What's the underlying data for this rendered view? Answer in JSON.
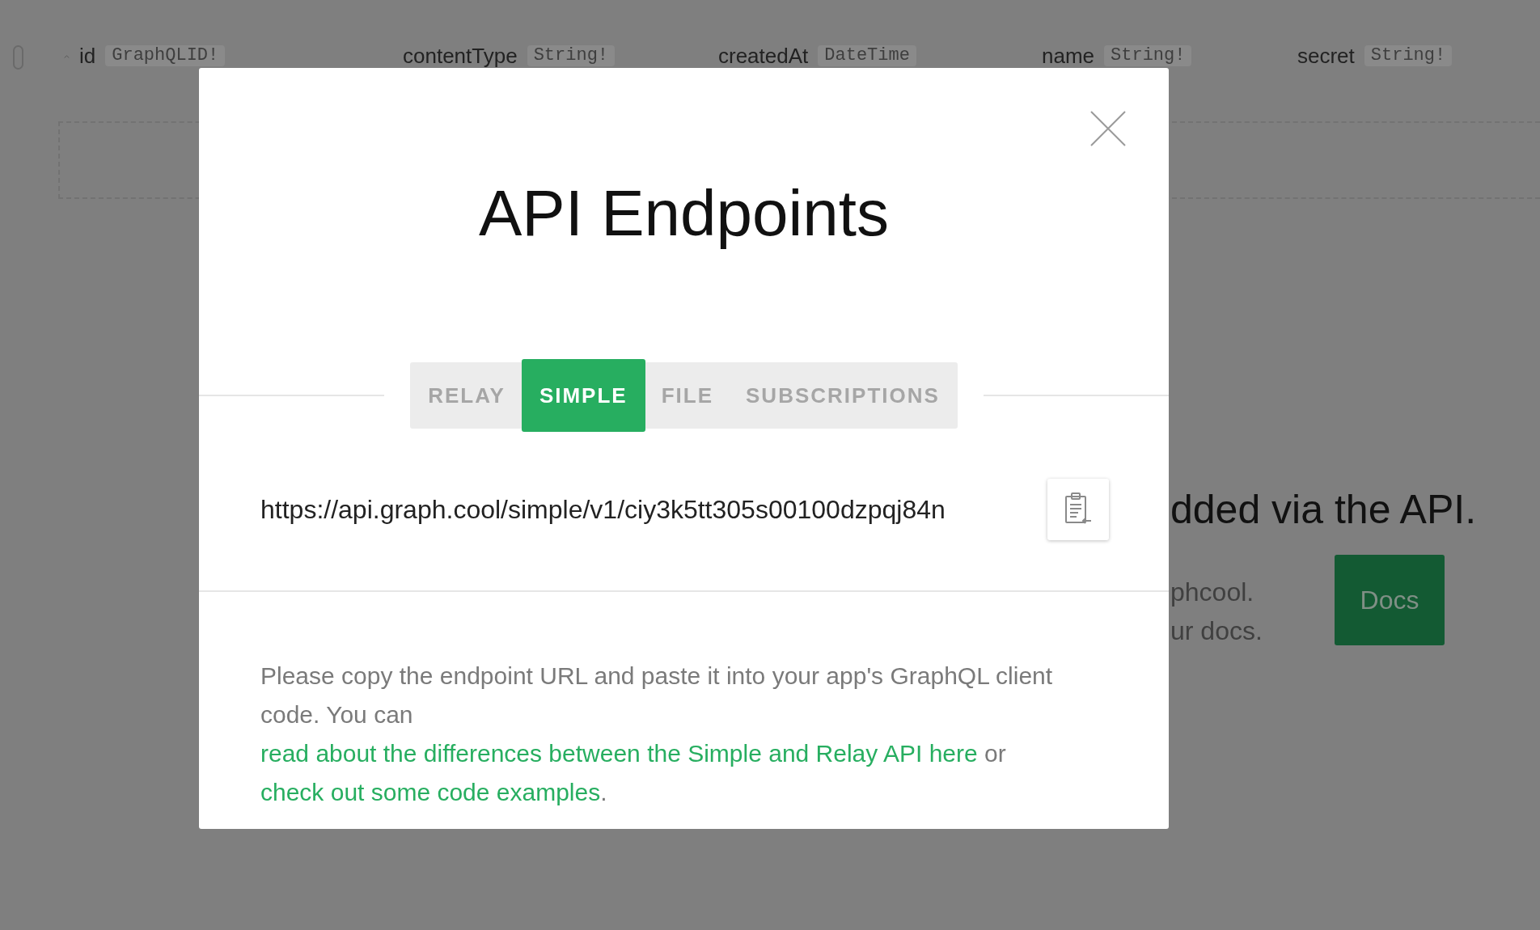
{
  "background": {
    "row_checked": false,
    "fields": [
      {
        "name": "id",
        "type": "GraphQLID!"
      },
      {
        "name": "contentType",
        "type": "String!"
      },
      {
        "name": "createdAt",
        "type": "DateTime"
      },
      {
        "name": "name",
        "type": "String!"
      },
      {
        "name": "secret",
        "type": "String!"
      }
    ],
    "empty_message": "dded via the API.",
    "hint_lines": [
      "phcool.",
      "ur docs."
    ],
    "docs_button": "Docs"
  },
  "modal": {
    "title": "API Endpoints",
    "tabs": [
      {
        "label": "RELAY",
        "selected": false
      },
      {
        "label": "SIMPLE",
        "selected": true
      },
      {
        "label": "FILE",
        "selected": false
      },
      {
        "label": "SUBSCRIPTIONS",
        "selected": false
      }
    ],
    "endpoint_url": "https://api.graph.cool/simple/v1/ciy3k5tt305s00100dzpqj84n",
    "description": [
      {
        "kind": "text",
        "text": "Please copy the endpoint URL and paste it into your app's GraphQL client code. You can "
      },
      {
        "kind": "link",
        "text": "read about the differences between the Simple and Relay API here"
      },
      {
        "kind": "text",
        "text": " or "
      },
      {
        "kind": "link",
        "text": "check out some code examples"
      },
      {
        "kind": "text",
        "text": "."
      }
    ]
  }
}
